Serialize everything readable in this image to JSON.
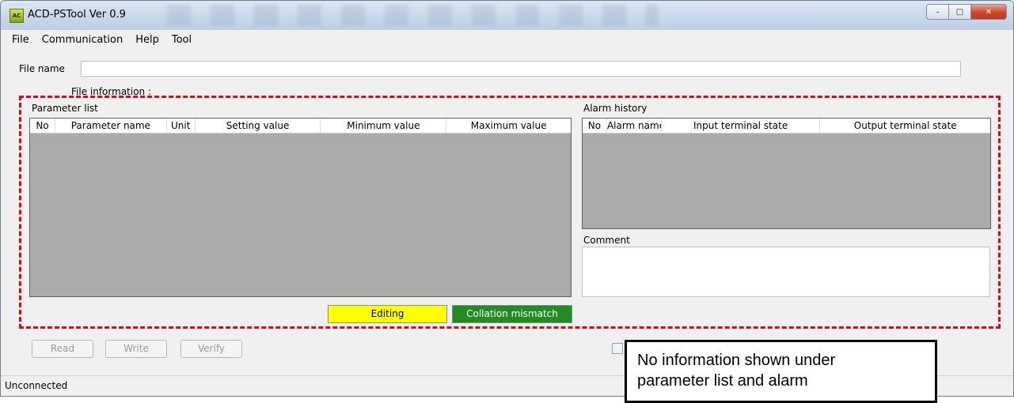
{
  "window": {
    "title": "ACD-PSTool  Ver 0.9",
    "icon": "app-icon",
    "controls": {
      "minimize": "–",
      "maximize": "□",
      "close": "✕"
    }
  },
  "menubar": {
    "items": [
      "File",
      "Communication",
      "Help",
      "Tool"
    ]
  },
  "file": {
    "name_label": "File name",
    "name_value": "",
    "info_label": "File information :"
  },
  "parameter_list": {
    "title": "Parameter list",
    "columns": [
      "No",
      "Parameter name",
      "Unit",
      "Setting value",
      "Minimum value",
      "Maximum value"
    ],
    "rows": []
  },
  "alarm_history": {
    "title": "Alarm history",
    "columns": [
      "No",
      "Alarm name",
      "Input terminal state",
      "Output terminal state"
    ],
    "rows": []
  },
  "comment": {
    "label": "Comment",
    "value": ""
  },
  "status_indicators": {
    "editing": {
      "label": "Editing",
      "color": "#ffff00"
    },
    "collation": {
      "label": "Collation mismatch",
      "color": "#228b22"
    }
  },
  "actions": {
    "read": "Read",
    "write": "Write",
    "verify": "Verify"
  },
  "statusbar": {
    "text": "Unconnected"
  },
  "annotation": {
    "callout_line1": "No information shown under",
    "callout_line2": "parameter list and alarm",
    "frame_color": "#e30613"
  }
}
